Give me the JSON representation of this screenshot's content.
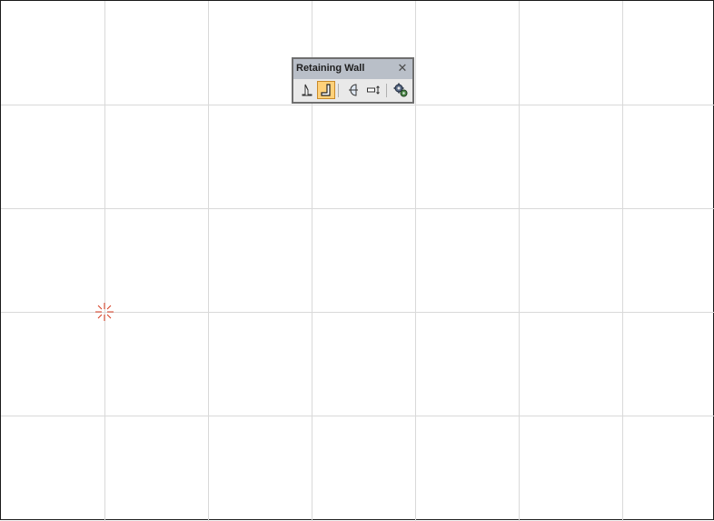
{
  "toolbar": {
    "title": "Retaining Wall",
    "close_label": "✕",
    "buttons": [
      {
        "name": "wall-profile-tool",
        "icon": "wall-profile-icon",
        "active": false
      },
      {
        "name": "l-shaped-wall-tool",
        "icon": "l-shape-wall-icon",
        "active": true
      },
      {
        "name": "circular-wall-tool",
        "icon": "semicircle-icon",
        "active": false
      },
      {
        "name": "wall-dimension-tool",
        "icon": "rectangle-arrow-icon",
        "active": false
      },
      {
        "name": "wall-settings-tool",
        "icon": "gears-icon",
        "active": false
      }
    ]
  },
  "canvas": {
    "grid_color": "#d9d9d9",
    "origin_marker_color": "#d63a1e",
    "background": "#ffffff"
  }
}
